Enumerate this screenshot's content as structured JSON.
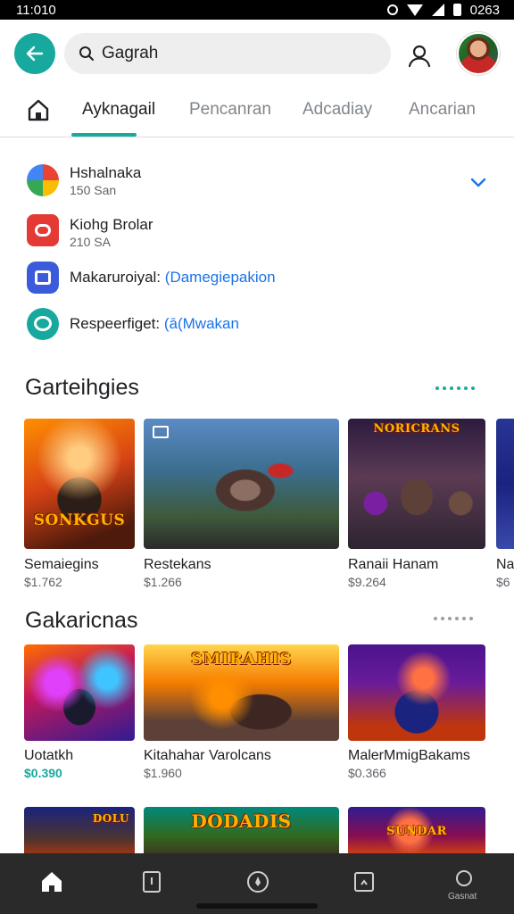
{
  "status_bar": {
    "time": "11:010",
    "battery": "0263"
  },
  "search": {
    "value": "Gagrah"
  },
  "tabs": [
    {
      "label": "Ayknagail",
      "active": true
    },
    {
      "label": "Pencanran",
      "active": false
    },
    {
      "label": "Adcadiay",
      "active": false
    },
    {
      "label": "Ancarian",
      "active": false
    }
  ],
  "list": [
    {
      "title": "Hshalnaka",
      "subtitle": "150 San",
      "icon": "pinwheel-app-icon"
    },
    {
      "title": "Kiohg Brolar",
      "subtitle": "210 SA",
      "icon": "red-app-icon"
    },
    {
      "title": "Makaruroiyal:",
      "link": "(Damegiepakion",
      "icon": "blue-app-icon"
    },
    {
      "title": "Respeerfiget:",
      "link": "(ā(Mwakan",
      "icon": "chat-app-icon"
    }
  ],
  "sections": [
    {
      "title": "Garteihgies",
      "cards": [
        {
          "name": "Semaiegins",
          "price": "$1.762",
          "art_text": "SONKGUS",
          "price_color": "#5f6368"
        },
        {
          "name": "Restekans",
          "price": "$1.266",
          "art_text": "",
          "price_color": "#5f6368"
        },
        {
          "name": "Ranaii Hanam",
          "price": "$9.264",
          "art_text": "NORICRANS",
          "price_color": "#5f6368"
        },
        {
          "name": "Na",
          "price": "$6",
          "art_text": "",
          "price_color": "#5f6368"
        }
      ]
    },
    {
      "title": "Gakaricnas",
      "cards": [
        {
          "name": "Uotatkh",
          "price": "$0.390",
          "art_text": "",
          "price_color": "#17a99e"
        },
        {
          "name": "Kitahahar Varolcans",
          "price": "$1.960",
          "art_text": "SMIRAHIS",
          "price_color": "#5f6368"
        },
        {
          "name": "MalerMmigBakams",
          "price": "$0.366",
          "art_text": "",
          "price_color": "#5f6368"
        }
      ]
    },
    {
      "title": "",
      "cards": [
        {
          "art_text": "DOLU"
        },
        {
          "art_text": "DODADIS"
        },
        {
          "art_text": "SUNDAR"
        }
      ]
    }
  ],
  "bottom_nav": {
    "last_label": "Gasnat"
  },
  "colors": {
    "accent": "#17a99e",
    "link": "#1a73e8",
    "nav_bg": "#2a2a2a"
  }
}
